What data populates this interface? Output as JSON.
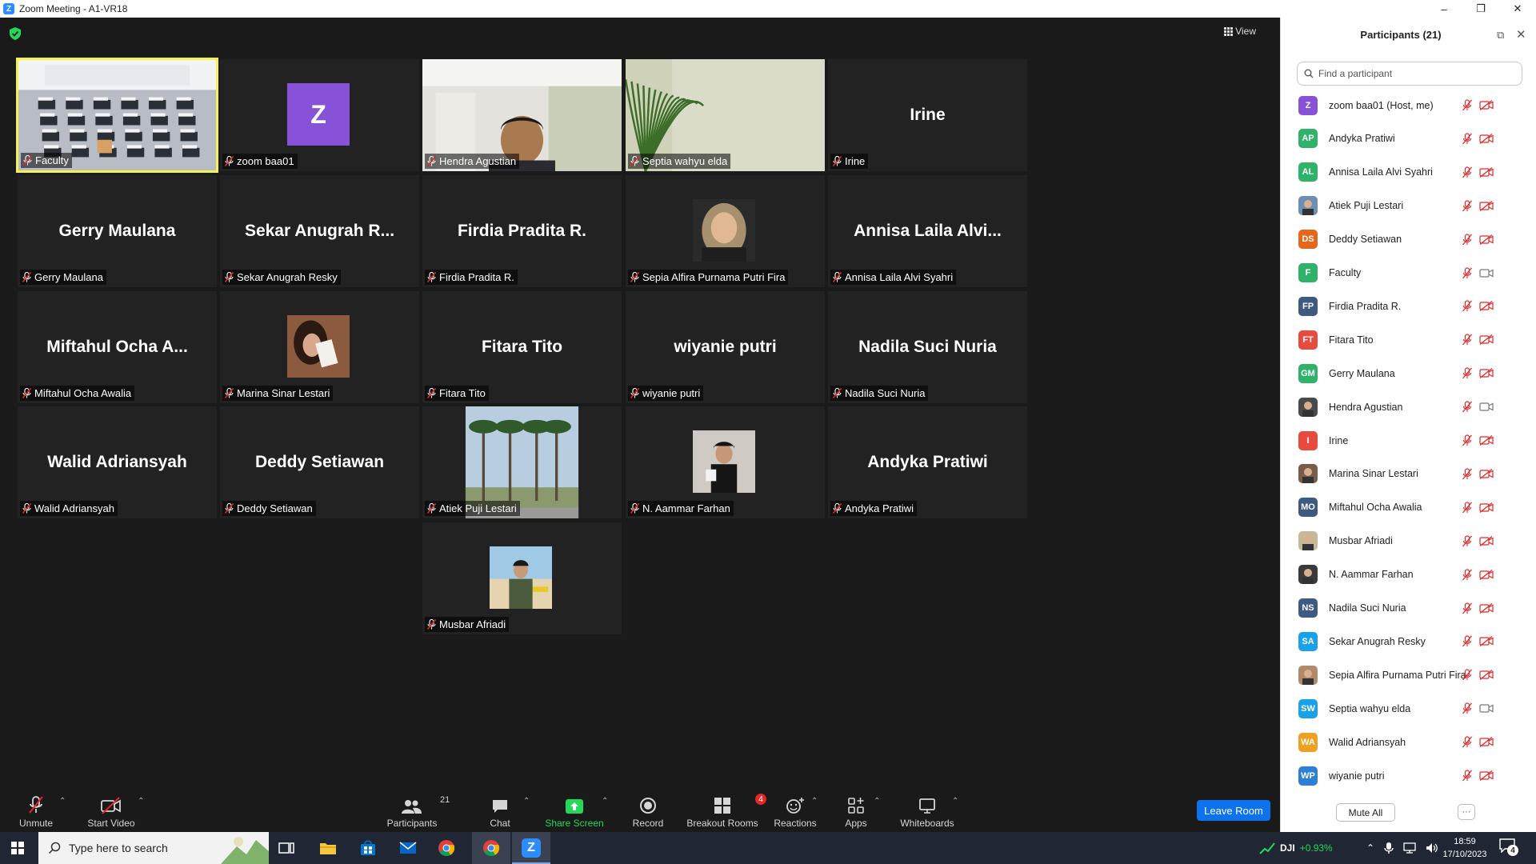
{
  "window": {
    "title": "Zoom Meeting - A1-VR18",
    "app_icon": "Z"
  },
  "header": {
    "view_label": "View"
  },
  "tiles": [
    {
      "big": "",
      "label": "Faculty",
      "kind": "classroom",
      "active": true
    },
    {
      "big": "",
      "label": "zoom baa01",
      "kind": "avatarZ",
      "avatar_letter": "Z"
    },
    {
      "big": "",
      "label": "Hendra Agustian",
      "kind": "office"
    },
    {
      "big": "",
      "label": "Septia wahyu elda",
      "kind": "plant"
    },
    {
      "big": "Irine",
      "label": "Irine",
      "kind": "name"
    },
    {
      "big": "Gerry Maulana",
      "label": "Gerry Maulana",
      "kind": "name"
    },
    {
      "big": "Sekar Anugrah R...",
      "label": "Sekar Anugrah Resky",
      "kind": "name"
    },
    {
      "big": "Firdia Pradita R.",
      "label": "Firdia Pradita R.",
      "kind": "name"
    },
    {
      "big": "",
      "label": "Sepia Alfira Purnama Putri Fira",
      "kind": "hijab"
    },
    {
      "big": "Annisa Laila Alvi...",
      "label": "Annisa Laila Alvi Syahri",
      "kind": "name"
    },
    {
      "big": "Miftahul Ocha A...",
      "label": "Miftahul Ocha Awalia",
      "kind": "name"
    },
    {
      "big": "",
      "label": "Marina Sinar Lestari",
      "kind": "girl"
    },
    {
      "big": "Fitara Tito",
      "label": "Fitara Tito",
      "kind": "name"
    },
    {
      "big": "wiyanie putri",
      "label": "wiyanie putri",
      "kind": "name"
    },
    {
      "big": "Nadila Suci Nuria",
      "label": "Nadila Suci Nuria",
      "kind": "name"
    },
    {
      "big": "Walid Adriansyah",
      "label": "Walid Adriansyah",
      "kind": "name"
    },
    {
      "big": "Deddy Setiawan",
      "label": "Deddy Setiawan",
      "kind": "name"
    },
    {
      "big": "",
      "label": "Atiek Puji Lestari",
      "kind": "palms"
    },
    {
      "big": "",
      "label": "N. Aammar Farhan",
      "kind": "boy"
    },
    {
      "big": "Andyka Pratiwi",
      "label": "Andyka Pratiwi",
      "kind": "name"
    },
    {
      "big": "",
      "label": "Musbar Afriadi",
      "kind": "beach"
    }
  ],
  "toolbar": {
    "unmute": "Unmute",
    "start_video": "Start Video",
    "participants": "Participants",
    "participants_count": "21",
    "chat": "Chat",
    "share_screen": "Share Screen",
    "record": "Record",
    "breakout_rooms": "Breakout Rooms",
    "breakout_badge": "4",
    "reactions": "Reactions",
    "apps": "Apps",
    "whiteboards": "Whiteboards",
    "leave_room": "Leave Room"
  },
  "panel": {
    "title": "Participants (21)",
    "search_placeholder": "Find a participant",
    "mute_all": "Mute All",
    "more": "···",
    "participants": [
      {
        "initials": "Z",
        "name": "zoom baa01 (Host, me)",
        "color": "#8751d8",
        "video": "off"
      },
      {
        "initials": "AP",
        "name": "Andyka Pratiwi",
        "color": "#2fb36b",
        "video": "off"
      },
      {
        "initials": "AL",
        "name": "Annisa Laila Alvi Syahri",
        "color": "#2fb36b",
        "video": "off"
      },
      {
        "initials": "",
        "name": "Atiek Puji Lestari",
        "color": "#6b8fb5",
        "video": "off",
        "photo": true
      },
      {
        "initials": "DS",
        "name": "Deddy Setiawan",
        "color": "#e8661a",
        "video": "off"
      },
      {
        "initials": "F",
        "name": "Faculty",
        "color": "#2fb36b",
        "video": "on"
      },
      {
        "initials": "FP",
        "name": "Firdia Pradita R.",
        "color": "#3d5a80",
        "video": "off"
      },
      {
        "initials": "FT",
        "name": "Fitara Tito",
        "color": "#e84a3d",
        "video": "off"
      },
      {
        "initials": "GM",
        "name": "Gerry Maulana",
        "color": "#2fb36b",
        "video": "off"
      },
      {
        "initials": "",
        "name": "Hendra Agustian",
        "color": "#4a4a4a",
        "video": "on",
        "photo": true
      },
      {
        "initials": "I",
        "name": "Irine",
        "color": "#e84a3d",
        "video": "off"
      },
      {
        "initials": "",
        "name": "Marina Sinar Lestari",
        "color": "#7a5c4a",
        "video": "off",
        "photo": true
      },
      {
        "initials": "MO",
        "name": "Miftahul Ocha Awalia",
        "color": "#3d5a80",
        "video": "off"
      },
      {
        "initials": "",
        "name": "Musbar Afriadi",
        "color": "#c8b89a",
        "video": "off",
        "photo": true
      },
      {
        "initials": "",
        "name": "N. Aammar Farhan",
        "color": "#3a3a3a",
        "video": "off",
        "photo": true
      },
      {
        "initials": "NS",
        "name": "Nadila Suci Nuria",
        "color": "#3d5a80",
        "video": "off"
      },
      {
        "initials": "SA",
        "name": "Sekar Anugrah Resky",
        "color": "#1aa2e8",
        "video": "off"
      },
      {
        "initials": "",
        "name": "Sepia Alfira Purnama Putri Fira",
        "color": "#b08a6a",
        "video": "off",
        "photo": true
      },
      {
        "initials": "SW",
        "name": "Septia wahyu elda",
        "color": "#1aa2e8",
        "video": "on"
      },
      {
        "initials": "WA",
        "name": "Walid Adriansyah",
        "color": "#f0a020",
        "video": "off"
      },
      {
        "initials": "WP",
        "name": "wiyanie putri",
        "color": "#2d7fd6",
        "video": "off"
      }
    ]
  },
  "taskbar": {
    "search_placeholder": "Type here to search",
    "stock_name": "DJI",
    "stock_change": "+0.93%",
    "time": "18:59",
    "date": "17/10/2023",
    "notification_count": "4"
  },
  "colors": {
    "accent": "#0e72ed",
    "share_green": "#23d959",
    "active_border": "#f3f05a",
    "mute_red": "#e02828"
  }
}
